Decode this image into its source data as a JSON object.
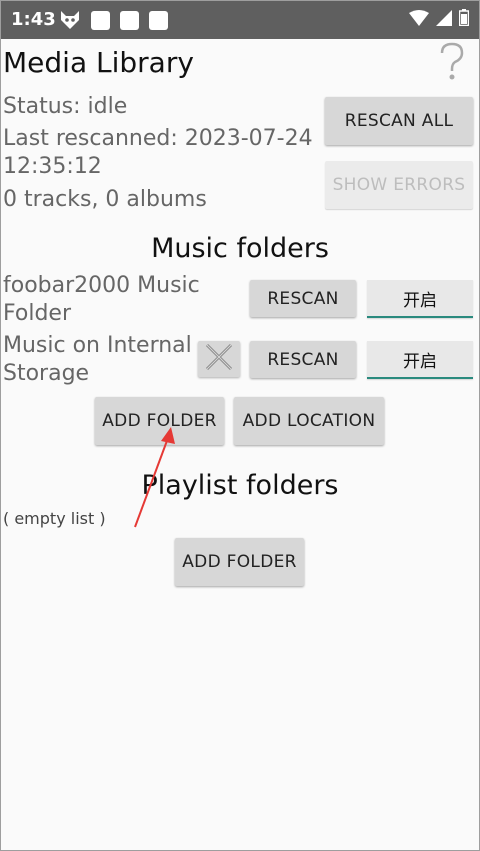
{
  "status_bar": {
    "time": "1:43",
    "icons": [
      "fox-icon",
      "notification-icon",
      "notification-icon",
      "notification-icon",
      "wifi-icon",
      "signal-icon",
      "battery-icon"
    ]
  },
  "header": {
    "title": "Media Library",
    "help_icon": "question-icon"
  },
  "info": {
    "status": "Status: idle",
    "last_rescanned_line1": "Last rescanned: 2023-07-24",
    "last_rescanned_line2": "12:35:12",
    "counts": "0 tracks, 0 albums"
  },
  "actions": {
    "rescan_all": "RESCAN ALL",
    "show_errors": "SHOW ERRORS"
  },
  "music_folders": {
    "title": "Music folders",
    "items": [
      {
        "name_line1": "foobar2000 Music",
        "name_line2": "Folder",
        "rescan": "RESCAN",
        "toggle": "开启"
      },
      {
        "name_line1": "Music on Internal",
        "name_line2": "Storage",
        "rescan": "RESCAN",
        "toggle": "开启"
      }
    ],
    "add_folder": "ADD FOLDER",
    "add_location": "ADD LOCATION"
  },
  "playlist_folders": {
    "title": "Playlist folders",
    "empty": "( empty list )",
    "add_folder": "ADD FOLDER"
  },
  "colors": {
    "status_bar": "#5f5f5f",
    "accent": "#2a8a7e",
    "button": "#d7d7d7",
    "annotation_arrow": "#e53935"
  }
}
